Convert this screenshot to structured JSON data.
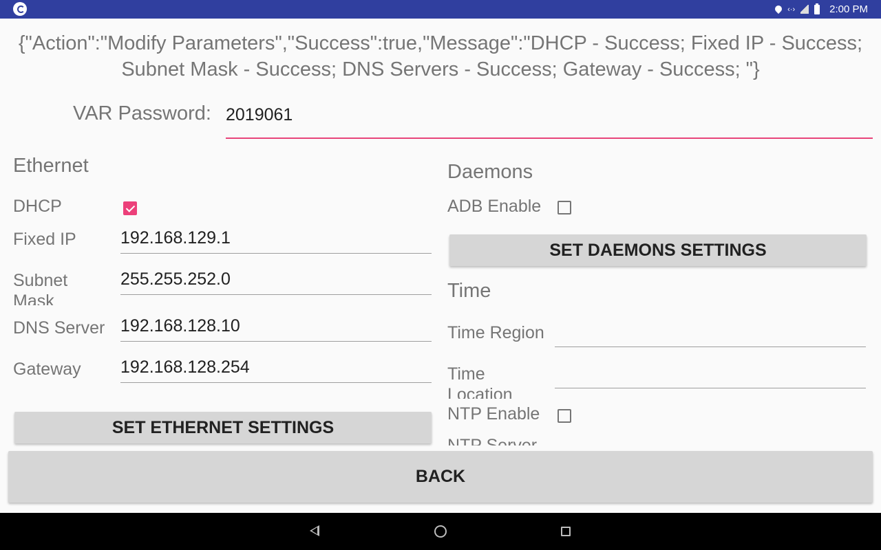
{
  "status_bar": {
    "time": "2:00 PM",
    "icons": [
      "app-icon",
      "location-icon",
      "code-icon",
      "no-signal-icon",
      "battery-icon"
    ],
    "background": "#303f9f"
  },
  "message": "{\"Action\":\"Modify Parameters\",\"Success\":true,\"Message\":\"DHCP - Success; Fixed IP - Success; Subnet Mask - Success; DNS Servers - Success; Gateway - Success; \"}",
  "password": {
    "label": "VAR Password:",
    "value": "2019061",
    "accent": "#e8437a"
  },
  "ethernet": {
    "title": "Ethernet",
    "dhcp_label": "DHCP",
    "dhcp_checked": true,
    "fixed_ip_label": "Fixed IP",
    "fixed_ip_value": "192.168.129.1",
    "subnet_label": "Subnet Mask",
    "subnet_value": "255.255.252.0",
    "dns_label": "DNS Server",
    "dns_value": "192.168.128.10",
    "gateway_label": "Gateway",
    "gateway_value": "192.168.128.254",
    "button": "SET ETHERNET SETTINGS"
  },
  "daemons": {
    "title": "Daemons",
    "adb_label": "ADB Enable",
    "adb_checked": false,
    "button": "SET DAEMONS SETTINGS"
  },
  "time": {
    "title": "Time",
    "region_label": "Time Region",
    "region_value": "",
    "location_label": "Time Location",
    "location_value": "",
    "ntp_enable_label": "NTP Enable",
    "ntp_checked": false,
    "ntp_server_label": "NTP Server"
  },
  "back_button": "BACK",
  "nav_bar": {
    "icons": [
      "back-icon",
      "home-icon",
      "recents-icon"
    ]
  }
}
